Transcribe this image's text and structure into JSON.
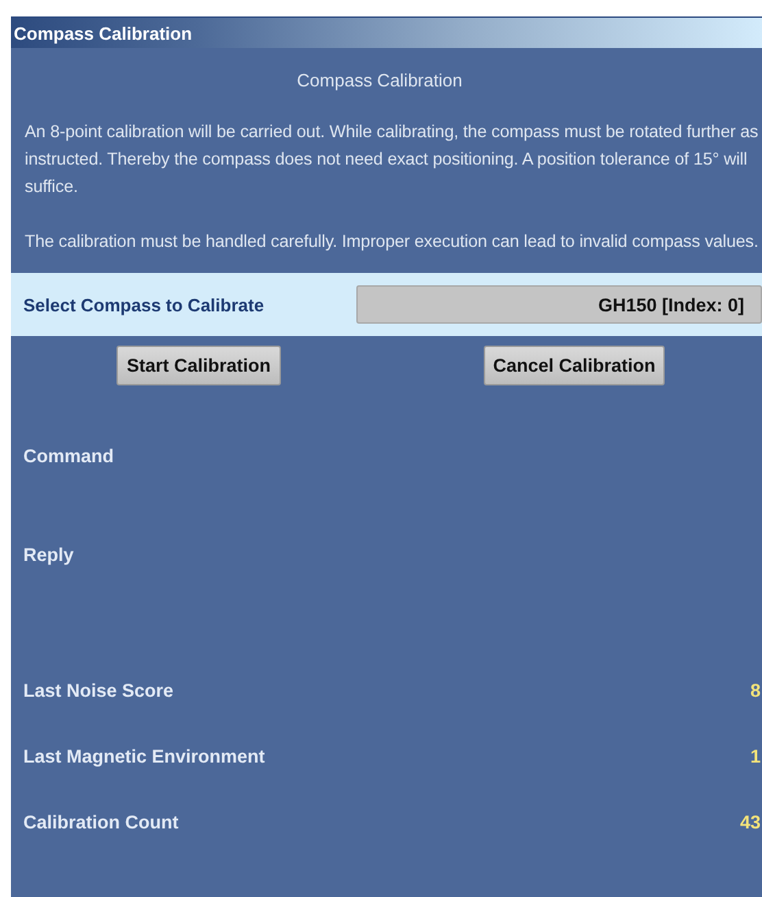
{
  "window": {
    "title": "Compass Calibration"
  },
  "heading": "Compass Calibration",
  "paragraphs": [
    "An 8-point calibration will be carried out. While calibrating, the compass must be rotated further as instructed. Thereby the compass does not need exact positioning. A position tolerance of 15° will suffice.",
    "The calibration must be handled carefully. Improper execution can lead to invalid compass values."
  ],
  "compass_select": {
    "label": "Select Compass to Calibrate",
    "value": "GH150 [Index: 0]"
  },
  "buttons": [
    "Start Calibration",
    "Cancel Calibration"
  ],
  "command": {
    "label": "Command"
  },
  "reply": {
    "label": "Reply"
  },
  "stats": [
    {
      "label": "Last Noise Score",
      "value": "8"
    },
    {
      "label": "Last Magnetic Environment",
      "value": "1"
    },
    {
      "label": "Calibration Count",
      "value": "43"
    }
  ]
}
